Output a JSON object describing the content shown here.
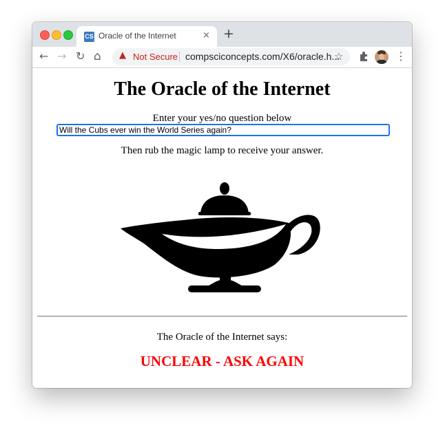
{
  "browser": {
    "tab_title": "Oracle of the Internet",
    "tab_favicon_text": "CS",
    "close_glyph": "×",
    "new_tab_glyph": "+",
    "security_label": "Not Secure",
    "url": "compsciconcepts.com/X6/oracle.h...",
    "icons": [
      "back-icon",
      "forward-icon",
      "reload-icon",
      "home-icon",
      "warning-icon",
      "star-icon",
      "extensions-icon",
      "avatar",
      "menu-icon"
    ],
    "colors": {
      "security_warning": "#c5221f",
      "tab_strip": "#dee1e6",
      "favicon": "#3b7bbf"
    }
  },
  "page": {
    "title": "The Oracle of the Internet",
    "prompt": "Enter your yes/no question below",
    "question_value": "Will the Cubs ever win the World Series again?",
    "rub_instruction": "Then rub the magic lamp to receive your answer.",
    "lamp_icon": "magic-lamp-icon",
    "result_label": "The Oracle of the Internet says:",
    "answer": "UNCLEAR - ASK AGAIN",
    "colors": {
      "answer": "#ff0000",
      "focus_ring": "#1a73e8"
    }
  }
}
